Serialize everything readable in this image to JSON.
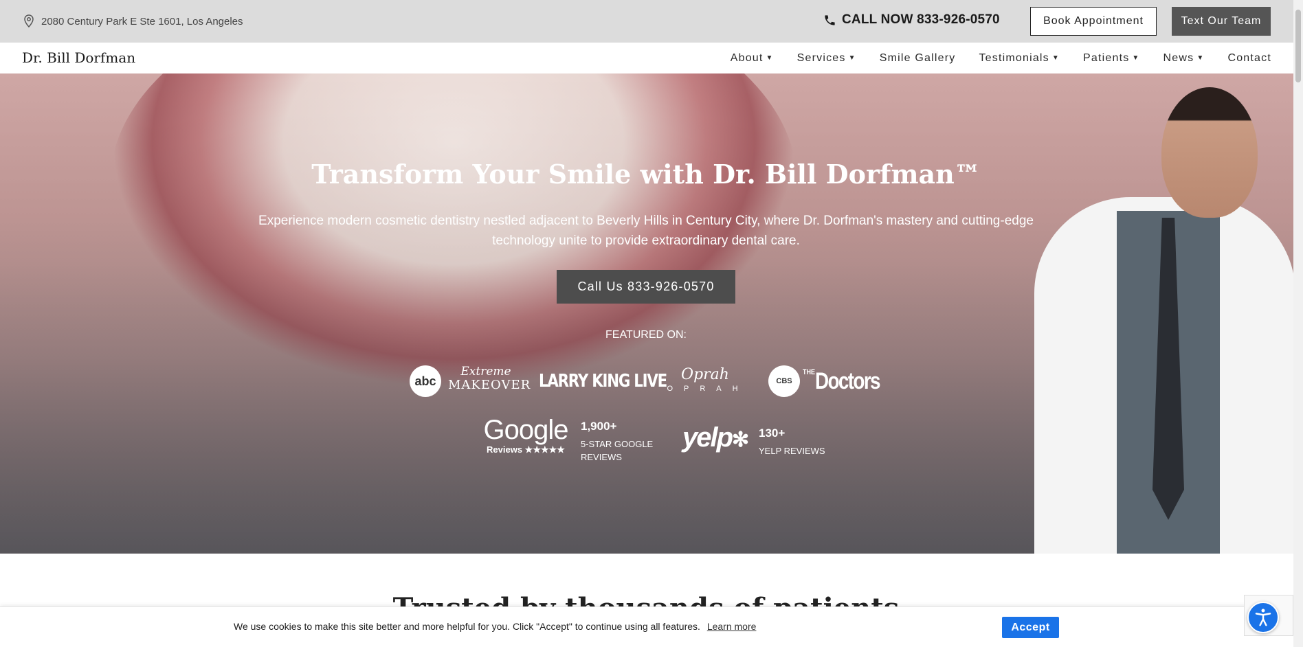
{
  "topbar": {
    "address": "2080 Century Park E Ste 1601, Los Angeles",
    "call_now": "CALL NOW 833-926-0570",
    "book_label": "Book Appointment",
    "text_label": "Text Our Team"
  },
  "navbar": {
    "logo": "Dr. Bill Dorfman",
    "items": [
      {
        "label": "About",
        "has_dropdown": true
      },
      {
        "label": "Services",
        "has_dropdown": true
      },
      {
        "label": "Smile Gallery",
        "has_dropdown": false
      },
      {
        "label": "Testimonials",
        "has_dropdown": true
      },
      {
        "label": "Patients",
        "has_dropdown": true
      },
      {
        "label": "News",
        "has_dropdown": true
      },
      {
        "label": "Contact",
        "has_dropdown": false
      }
    ]
  },
  "hero": {
    "title": "Transform Your Smile with Dr. Bill Dorfman™",
    "subtitle": "Experience modern cosmetic dentistry nestled adjacent to Beverly Hills in Century City, where Dr. Dorfman's mastery and cutting-edge technology unite to provide extraordinary dental care.",
    "call_button": "Call Us 833-926-0570",
    "featured_label": "FEATURED ON:",
    "logos": {
      "abc": "abc",
      "extreme": "Extreme",
      "makeover": "MAKEOVER",
      "larry_king": "LARRY KING LIVE",
      "oprah_sig": "Oprah",
      "oprah_word": "OPRAH",
      "cbs": "CBS",
      "doctors_the": "THE",
      "doctors": "Doctors"
    },
    "google": {
      "logo": "Google",
      "sub": "Reviews ★★★★★",
      "count": "1,900+",
      "label": "5-STAR GOOGLE REVIEWS"
    },
    "yelp": {
      "logo": "yelp",
      "count": "130+",
      "label": "YELP REVIEWS"
    }
  },
  "section": {
    "trusted_title": "Trusted by thousands of patients"
  },
  "cookie": {
    "text": "We use cookies to make this site better and more helpful for you. Click \"Accept\" to continue using all features.",
    "link": "Learn more",
    "accept": "Accept"
  },
  "colors": {
    "topbar_bg": "#dcdcdc",
    "button_dark": "#555555",
    "accept_blue": "#1a73e8"
  }
}
